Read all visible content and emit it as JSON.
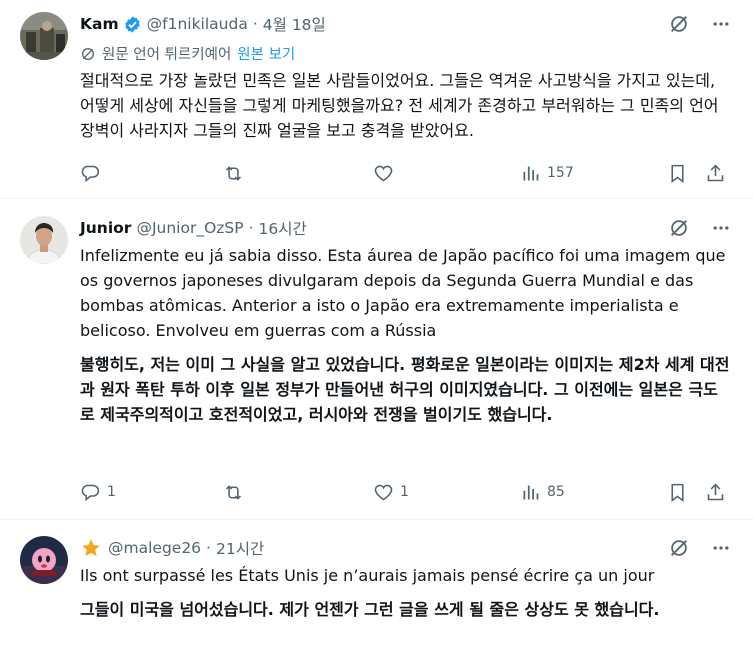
{
  "posts": [
    {
      "name": "Kam",
      "handle": "@f1nikilauda",
      "dot": "·",
      "time": "4월 18일",
      "translation_note": "원문 언어 튀르키예어",
      "translation_link": "원본 보기",
      "text": "절대적으로 가장 놀랐던 민족은 일본 사람들이었어요. 그들은 역겨운 사고방식을 가지고 있는데, 어떻게 세상에 자신들을 그렇게 마케팅했을까요? 전 세계가 존경하고 부러워하는 그 민족의 언어 장벽이 사라지자 그들의 진짜 얼굴을 보고 충격을 받았어요.",
      "replies": "",
      "likes": "",
      "views": "157"
    },
    {
      "name": "Junior",
      "handle": "@Junior_OzSP",
      "dot": "·",
      "time": "16시간",
      "text": "Infelizmente eu já sabia disso. Esta áurea de Japão pacífico foi uma imagem que os governos japoneses divulgaram depois da Segunda Guerra Mundial e das bombas atômicas. Anterior a isto o Japão era extremamente imperialista e belicoso. Envolveu em guerras com a Rússia",
      "translation": "불행히도, 저는 이미 그 사실을 알고 있었습니다. 평화로운 일본이라는 이미지는 제2차 세계 대전과 원자 폭탄 투하 이후 일본 정부가 만들어낸 허구의 이미지였습니다. 그 이전에는 일본은 극도로 제국주의적이고 호전적이었고, 러시아와 전쟁을 벌이기도 했습니다.",
      "replies": "1",
      "likes": "1",
      "views": "85"
    },
    {
      "handle": "@malege26",
      "dot": "·",
      "time": "21시간",
      "text": "Ils ont surpassé les États Unis je n’aurais jamais pensé écrire ça un jour",
      "translation": "그들이 미국을 넘어섰습니다. 제가 언젠가 그런 글을 쓰게 될 줄은 상상도 못 했습니다."
    }
  ],
  "colors": {
    "text": "#0f1419",
    "secondary": "#536471",
    "link": "#1d9bf0",
    "verified": "#1d9bf0",
    "star": "#f4a522",
    "divider": "#eff3f4"
  },
  "icons": {
    "verified": "verified-badge-icon",
    "translate": "translate-icon",
    "grok": "grok-icon",
    "more": "more-icon",
    "reply": "reply-icon",
    "repost": "repost-icon",
    "like": "like-icon",
    "views": "views-icon",
    "bookmark": "bookmark-icon",
    "share": "share-icon",
    "star": "star-icon"
  }
}
